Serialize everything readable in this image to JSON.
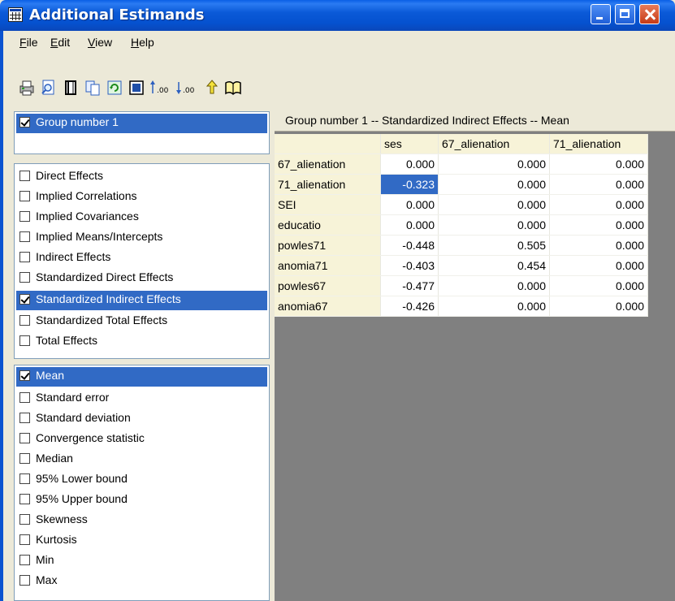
{
  "window": {
    "title": "Additional Estimands"
  },
  "menu": {
    "items": [
      {
        "label": "File",
        "underline": "F",
        "rest": "ile"
      },
      {
        "label": "Edit",
        "underline": "E",
        "rest": "dit"
      },
      {
        "label": "View",
        "underline": "V",
        "rest": "iew"
      },
      {
        "label": "Help",
        "underline": "H",
        "rest": "elp"
      }
    ]
  },
  "toolbar": {
    "icons": [
      "print-icon",
      "preview-icon",
      "copy-page-icon",
      "copy-icon",
      "refresh-icon",
      "options-icon",
      "increase-decimals-icon",
      "decrease-decimals-icon",
      "hint-icon",
      "help-book-icon"
    ]
  },
  "groups": {
    "items": [
      {
        "label": "Group number 1",
        "checked": true,
        "selected": true
      }
    ]
  },
  "estimands": {
    "items": [
      {
        "label": "Direct Effects",
        "checked": false
      },
      {
        "label": "Implied Correlations",
        "checked": false
      },
      {
        "label": "Implied Covariances",
        "checked": false
      },
      {
        "label": "Implied Means/Intercepts",
        "checked": false
      },
      {
        "label": "Indirect Effects",
        "checked": false
      },
      {
        "label": "Standardized Direct Effects",
        "checked": false
      },
      {
        "label": "Standardized Indirect Effects",
        "checked": true,
        "selected": true
      },
      {
        "label": "Standardized Total Effects",
        "checked": false
      },
      {
        "label": "Total Effects",
        "checked": false
      }
    ]
  },
  "statistics": {
    "items": [
      {
        "label": "Mean",
        "checked": true,
        "selected": true
      },
      {
        "label": "Standard error",
        "checked": false
      },
      {
        "label": "Standard deviation",
        "checked": false
      },
      {
        "label": "Convergence statistic",
        "checked": false
      },
      {
        "label": "Median",
        "checked": false
      },
      {
        "label": "95% Lower bound",
        "checked": false
      },
      {
        "label": "95% Upper bound",
        "checked": false
      },
      {
        "label": "Skewness",
        "checked": false
      },
      {
        "label": "Kurtosis",
        "checked": false
      },
      {
        "label": "Min",
        "checked": false
      },
      {
        "label": "Max",
        "checked": false
      }
    ]
  },
  "results": {
    "header": "Group number 1 -- Standardized Indirect Effects -- Mean",
    "columns": [
      "ses",
      "67_alienation",
      "71_alienation"
    ],
    "rows": [
      {
        "label": "67_alienation",
        "values": [
          "0.000",
          "0.000",
          "0.000"
        ]
      },
      {
        "label": "71_alienation",
        "values": [
          "-0.323",
          "0.000",
          "0.000"
        ]
      },
      {
        "label": "SEI",
        "values": [
          "0.000",
          "0.000",
          "0.000"
        ]
      },
      {
        "label": "educatio",
        "values": [
          "0.000",
          "0.000",
          "0.000"
        ]
      },
      {
        "label": "powles71",
        "values": [
          "-0.448",
          "0.505",
          "0.000"
        ]
      },
      {
        "label": "anomia71",
        "values": [
          "-0.403",
          "0.454",
          "0.000"
        ]
      },
      {
        "label": "powles67",
        "values": [
          "-0.477",
          "0.000",
          "0.000"
        ]
      },
      {
        "label": "anomia67",
        "values": [
          "-0.426",
          "0.000",
          "0.000"
        ]
      }
    ],
    "selected_cell": {
      "row": 1,
      "col": 0
    }
  }
}
